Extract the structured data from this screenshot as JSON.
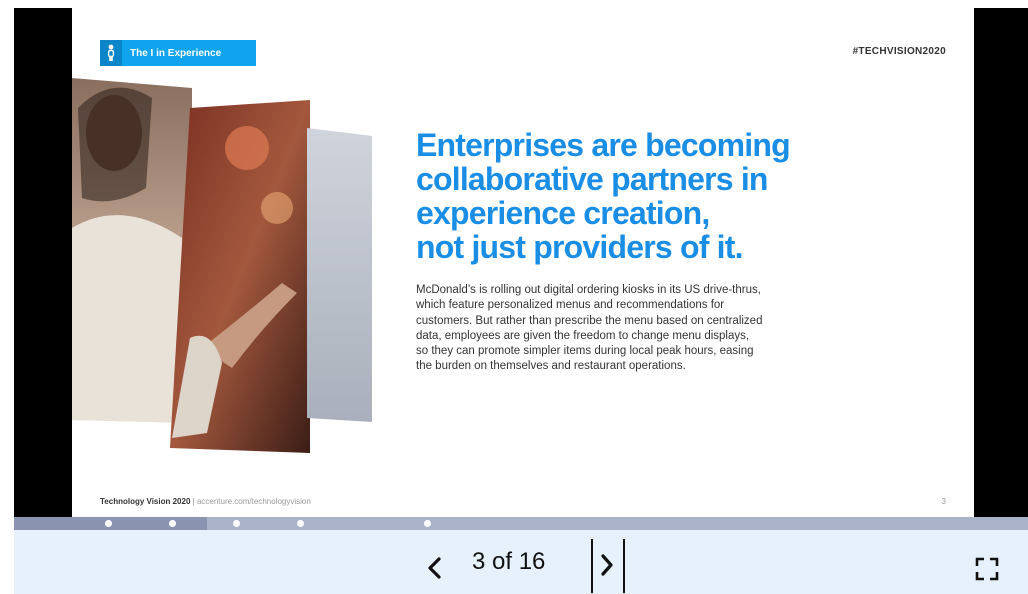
{
  "slide": {
    "tag_label": "The I in Experience",
    "hashtag": "#TECHVISION2020",
    "headline_lines": [
      "Enterprises are becoming",
      "collaborative partners in",
      "experience creation,",
      "not just providers of it."
    ],
    "body_lines": [
      "McDonald’s is rolling out digital ordering kiosks in its US drive-thrus,",
      "which feature personalized menus and recommendations for",
      "customers. But rather than prescribe the menu based on centralized",
      "data, employees are given the freedom to change menu displays,",
      "so they can promote simpler items during local peak hours, easing",
      "the burden on themselves and restaurant operations."
    ],
    "footer_brand": "Technology Vision 2020",
    "footer_separator": "|",
    "footer_url": "accenture.com/technologyvision",
    "page_number": "3"
  },
  "viewer": {
    "progress": 0.19,
    "counter": "3 of 16",
    "prev_icon": "chevron-left-icon",
    "next_icon": "chevron-right-icon",
    "fullscreen_icon": "fullscreen-icon",
    "accent_color": "#1a8ee5",
    "tag_color": "#10a3ee"
  }
}
